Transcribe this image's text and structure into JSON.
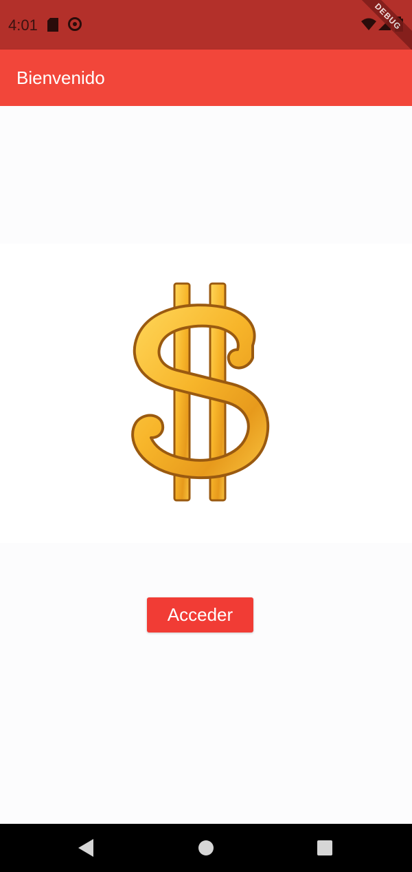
{
  "status_bar": {
    "time": "4:01",
    "debug_label": "DEBUG",
    "icons": [
      "sd-card-icon",
      "sync-icon",
      "wifi-icon",
      "signal-icon",
      "battery-icon"
    ]
  },
  "app_bar": {
    "title": "Bienvenido"
  },
  "main": {
    "logo_icon": "dollar-sign-icon",
    "access_button_label": "Acceder"
  },
  "nav_bar": {
    "icons": [
      "back-icon",
      "home-icon",
      "recents-icon"
    ]
  },
  "colors": {
    "status_bar": "#b3302a",
    "app_bar": "#f2463a",
    "button": "#f13c35",
    "dollar_gold": "#f6b929"
  }
}
